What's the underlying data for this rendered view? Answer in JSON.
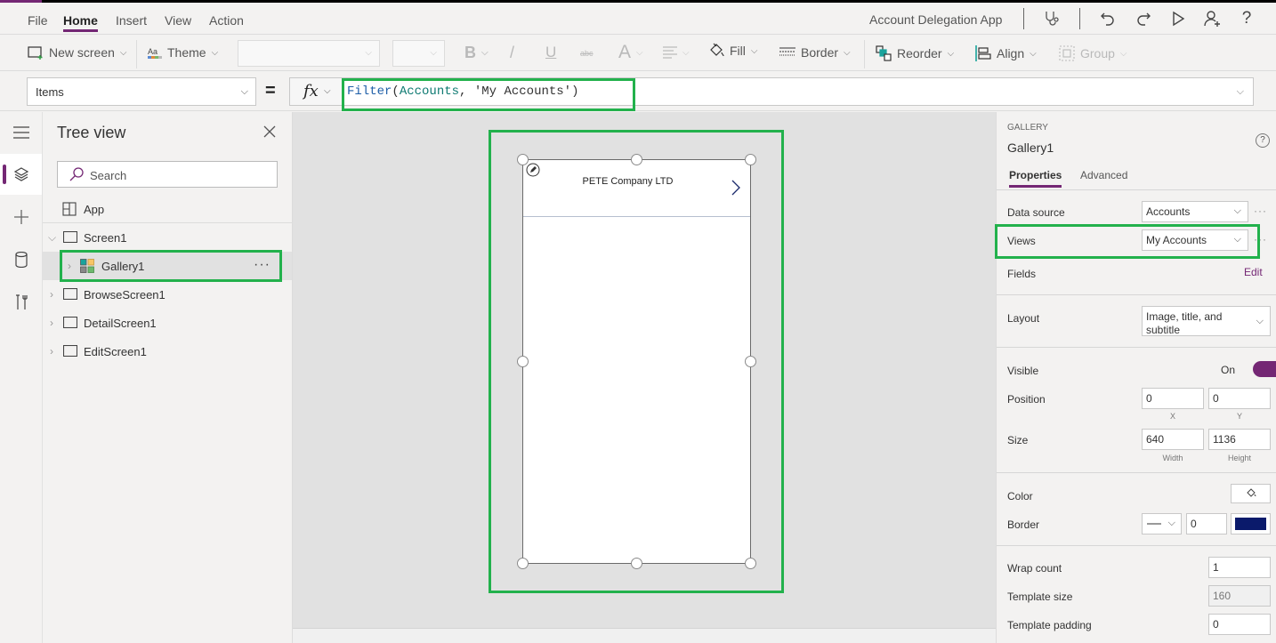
{
  "menubar": {
    "items": [
      "File",
      "Home",
      "Insert",
      "View",
      "Action"
    ],
    "active": "Home",
    "app_title": "Account Delegation App"
  },
  "ribbon": {
    "new_screen": "New screen",
    "theme": "Theme",
    "bold": "B",
    "italic": "/",
    "underline": "U",
    "strikethrough": "abc",
    "font_size": "A",
    "fill": "Fill",
    "border": "Border",
    "reorder": "Reorder",
    "align": "Align",
    "group": "Group"
  },
  "formula": {
    "property": "Items",
    "equals": "=",
    "fx": "fx",
    "tokens": {
      "fn": "Filter",
      "open": "(",
      "arg1": "Accounts",
      "comma": ", ",
      "arg2": "'My Accounts'",
      "close": ")"
    }
  },
  "treeview": {
    "title": "Tree view",
    "search_placeholder": "Search",
    "app": "App",
    "items": [
      {
        "label": "Screen1",
        "expanded": true
      },
      {
        "label": "Gallery1",
        "selected": true
      },
      {
        "label": "BrowseScreen1"
      },
      {
        "label": "DetailScreen1"
      },
      {
        "label": "EditScreen1"
      }
    ],
    "more": "···"
  },
  "canvas": {
    "gallery_item_title": "PETE Company LTD"
  },
  "properties": {
    "control_type": "GALLERY",
    "control_name": "Gallery1",
    "help": "?",
    "tabs": [
      "Properties",
      "Advanced"
    ],
    "active_tab": "Properties",
    "data_source_label": "Data source",
    "data_source_value": "Accounts",
    "views_label": "Views",
    "views_value": "My Accounts",
    "fields_label": "Fields",
    "fields_edit": "Edit",
    "layout_label": "Layout",
    "layout_value": "Image, title, and subtitle",
    "visible_label": "Visible",
    "visible_state": "On",
    "visible_on": true,
    "position_label": "Position",
    "position_x": "0",
    "position_y": "0",
    "x_label": "X",
    "y_label": "Y",
    "size_label": "Size",
    "width": "640",
    "height": "1136",
    "width_label": "Width",
    "height_label": "Height",
    "color_label": "Color",
    "border_label": "Border",
    "border_width": "0",
    "border_color": "#0a1a6b",
    "wrap_count_label": "Wrap count",
    "wrap_count": "1",
    "template_size_label": "Template size",
    "template_size": "160",
    "template_padding_label": "Template padding",
    "template_padding": "0",
    "more": "···"
  },
  "colors": {
    "accent": "#742774",
    "highlight": "#22b14c"
  }
}
